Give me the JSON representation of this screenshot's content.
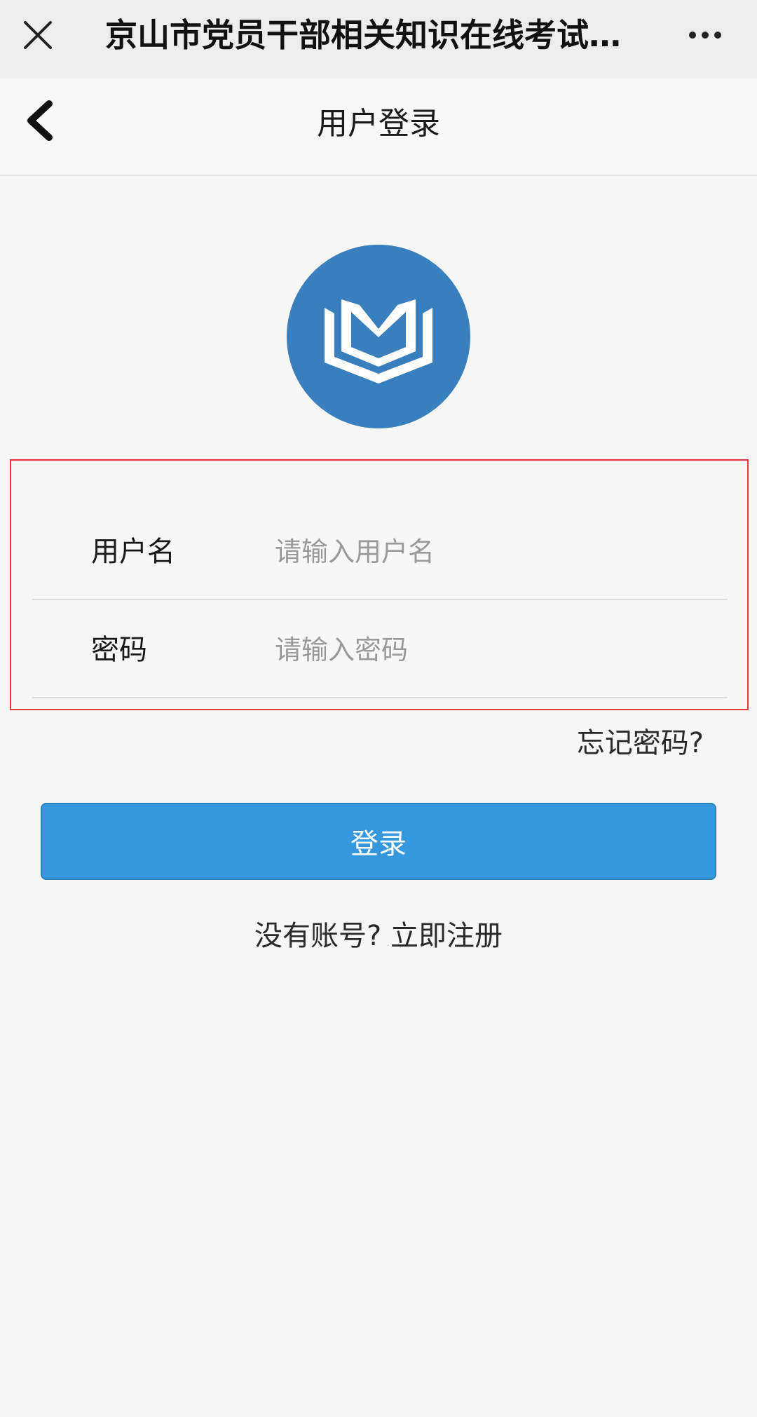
{
  "wechat_bar": {
    "title": "京山市党员干部相关知识在线考试...",
    "close_icon": "close-icon",
    "more_icon": "more-dots-icon"
  },
  "nav": {
    "title": "用户登录",
    "back_icon": "chevron-left-icon"
  },
  "logo": {
    "icon": "open-book-logo-icon",
    "bg_color": "#3a7fbd"
  },
  "form": {
    "username": {
      "label": "用户名",
      "placeholder": "请输入用户名",
      "value": ""
    },
    "password": {
      "label": "密码",
      "placeholder": "请输入密码",
      "value": ""
    },
    "highlight_color": "#e23a3a"
  },
  "forgot_password": "忘记密码?",
  "login_button": {
    "label": "登录",
    "color": "#3698dc"
  },
  "register": {
    "prompt": "没有账号?",
    "link": "立即注册"
  }
}
